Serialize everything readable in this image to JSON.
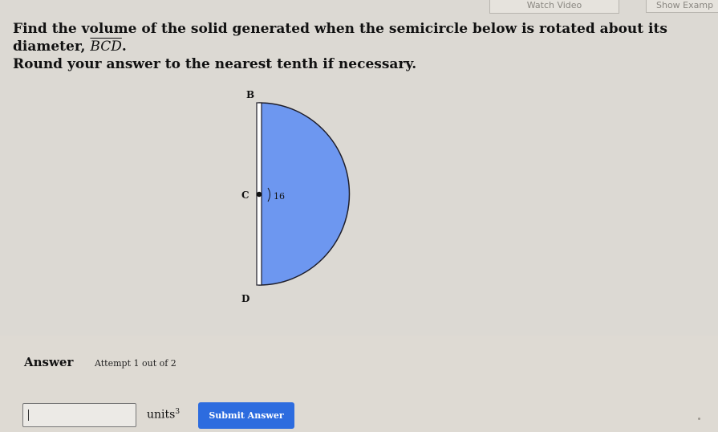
{
  "top": {
    "button1": "Watch Video",
    "button2": "Show Examp"
  },
  "question": {
    "line1_prefix": "Find the volume of the solid generated when the semicircle below is rotated about its diameter, ",
    "segment": "BCD",
    "line1_suffix": ".",
    "line2": "Round your answer to the nearest tenth if necessary."
  },
  "figure": {
    "label_top": "B",
    "label_center": "C",
    "label_bottom": "D",
    "radius_label": "16",
    "fill_color": "#6d97f0",
    "stroke_color": "#1e1e2a"
  },
  "answer": {
    "title": "Answer",
    "attempt": "Attempt 1 out of 2",
    "input_value": "",
    "units": "units",
    "units_exp": "3",
    "submit_label": "Submit Answer"
  },
  "colors": {
    "submit_bg": "#2d6cdf",
    "page_bg": "#dcd9d3"
  }
}
